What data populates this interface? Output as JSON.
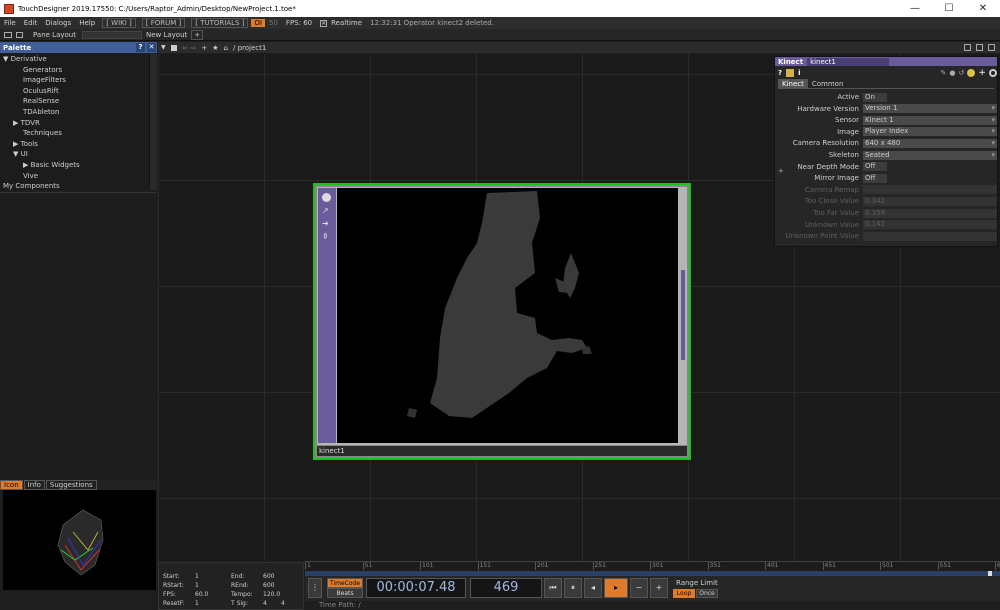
{
  "window": {
    "title": "TouchDesigner 2019.17550: C:/Users/Raptor_Admin/Desktop/NewProject.1.toe*",
    "minimize": "—",
    "maximize": "☐",
    "close": "✕"
  },
  "menu": {
    "items": [
      "File",
      "Edit",
      "Dialogs",
      "Help"
    ],
    "wiki": "[ WIKI ]",
    "forum": "[ FORUM ]",
    "tutorials": "[ TUTORIALS ]",
    "oi": "OI",
    "oi_num": "50",
    "fps": "FPS: 60",
    "realtime": "Realtime",
    "status": "12:32:31 Operator kinect2 deleted."
  },
  "toolbar2": {
    "pane_layout": "Pane Layout",
    "new_layout": "New Layout",
    "add": "+"
  },
  "palette": {
    "title": "Palette",
    "help": "?",
    "close": "✕",
    "items": [
      {
        "label": "▼ Derivative",
        "indent": 0
      },
      {
        "label": "Generators",
        "indent": 2
      },
      {
        "label": "ImageFilters",
        "indent": 2
      },
      {
        "label": "OculusRift",
        "indent": 2
      },
      {
        "label": "RealSense",
        "indent": 2
      },
      {
        "label": "TDAbleton",
        "indent": 2
      },
      {
        "label": "▶ TDVR",
        "indent": 1
      },
      {
        "label": "Techniques",
        "indent": 2
      },
      {
        "label": "▶ Tools",
        "indent": 1
      },
      {
        "label": "▼ UI",
        "indent": 1
      },
      {
        "label": "▶ Basic Widgets",
        "indent": 2
      },
      {
        "label": "Vive",
        "indent": 2
      },
      {
        "label": "My Components",
        "indent": 0
      }
    ]
  },
  "op_tabs": [
    "Icon",
    "Info",
    "Suggestions"
  ],
  "pane": {
    "path": "/ project1"
  },
  "node": {
    "name": "kinect1"
  },
  "params": {
    "op_type": "Kinect",
    "op_name": "kinect1",
    "tabs": [
      "Kinect",
      "Common"
    ],
    "rows": [
      {
        "label": "Active",
        "value": "On",
        "dim": false,
        "dd": false
      },
      {
        "label": "Hardware Version",
        "value": "Version 1",
        "dim": false,
        "dd": true
      },
      {
        "label": "Sensor",
        "value": "Kinect 1",
        "dim": false,
        "dd": true
      },
      {
        "label": "Image",
        "value": "Player Index",
        "dim": false,
        "dd": true
      },
      {
        "label": "Camera Resolution",
        "value": "640 x 480",
        "dim": false,
        "dd": true
      },
      {
        "label": "Skeleton",
        "value": "Seated",
        "dim": false,
        "dd": true
      },
      {
        "label": "Near Depth Mode",
        "value": "Off",
        "dim": false,
        "dd": false
      },
      {
        "label": "Mirror Image",
        "value": "Off",
        "dim": false,
        "dd": false
      },
      {
        "label": "Camera Remap",
        "value": "",
        "dim": true,
        "dd": false
      },
      {
        "label": "Too Close Value",
        "value": "0.342",
        "dim": true,
        "dd": false
      },
      {
        "label": "Too Far Value",
        "value": "0.358",
        "dim": true,
        "dd": false
      },
      {
        "label": "Unknown Value",
        "value": "0.142",
        "dim": true,
        "dd": false
      },
      {
        "label": "Unknown Point Value",
        "value": "",
        "dim": true,
        "dd": false
      }
    ]
  },
  "timeline": {
    "ticks": [
      "1",
      "51",
      "101",
      "151",
      "201",
      "251",
      "301",
      "351",
      "401",
      "451",
      "501",
      "551",
      "600"
    ],
    "info": {
      "start_label": "Start:",
      "start": "1",
      "end_label": "End:",
      "end": "600",
      "rstart_label": "RStart:",
      "rstart": "1",
      "rend_label": "REnd:",
      "rend": "600",
      "fps_label": "FPS:",
      "fps": "60.0",
      "tempo_label": "Tempo:",
      "tempo": "120.0",
      "resetf_label": "ResetF:",
      "resetf": "1",
      "tsig_label": "T Sig:",
      "tsig_a": "4",
      "tsig_b": "4"
    },
    "timecode": "TimeCode",
    "beats": "Beats",
    "time": "00:00:07.48",
    "frame": "469",
    "range_limit": "Range Limit",
    "loop": "Loop",
    "once": "Once",
    "time_path": "Time Path: /"
  },
  "colors": {
    "palette_header": "#3f5e9a",
    "node_border": "#16c516",
    "comp_purple": "#6a5b9a",
    "accent_orange": "#e07b2a"
  }
}
